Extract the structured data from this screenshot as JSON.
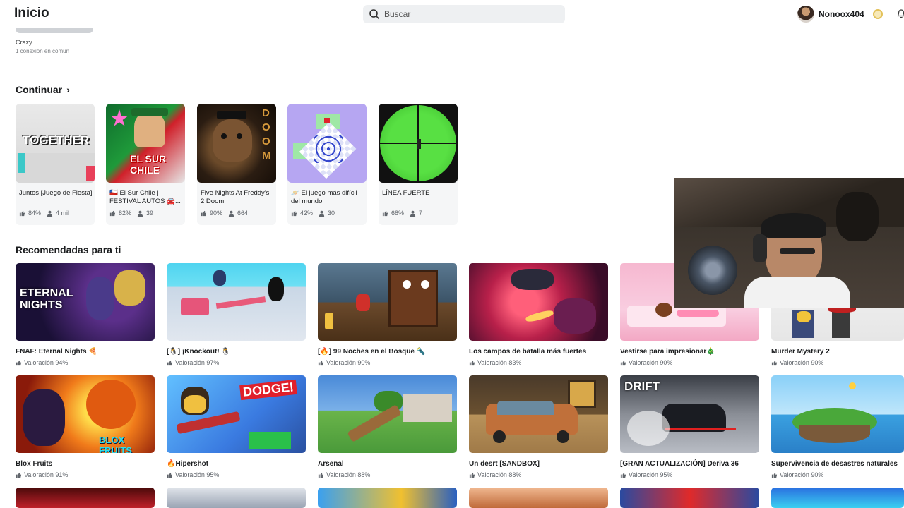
{
  "header": {
    "title": "Inicio",
    "search_placeholder": "Buscar",
    "username": "Nonoox404"
  },
  "friend": {
    "name": "Crazy",
    "subtitle": "1 conexión en común"
  },
  "continue_section": {
    "title": "Continuar",
    "items": [
      {
        "name": "Juntos [Juego de Fiesta]",
        "rating": "84%",
        "players": "4 mil",
        "thumb_text": "TOGETHER"
      },
      {
        "name": "🇨🇱 El Sur Chile | FESTIVAL AUTOS 🚘...",
        "rating": "82%",
        "players": "39",
        "thumb_text": "EL SUR CHILE"
      },
      {
        "name": "Five Nights At Freddy's 2 Doom",
        "rating": "90%",
        "players": "664",
        "thumb_text": "DOOM"
      },
      {
        "name": "🪐 El juego más difícil del mundo",
        "rating": "42%",
        "players": "30",
        "thumb_text": ""
      },
      {
        "name": "LÍNEA FUERTE",
        "rating": "68%",
        "players": "7",
        "thumb_text": ""
      }
    ]
  },
  "recommended_section": {
    "title": "Recomendadas para ti",
    "rows": [
      [
        {
          "name": "FNAF: Eternal Nights 🍕",
          "rating": "Valoración 94%",
          "thumb_text": "ETERNAL NIGHTS"
        },
        {
          "name": "[🐧] ¡Knockout! 🐧",
          "rating": "Valoración 97%",
          "thumb_text": ""
        },
        {
          "name": "[🔥] 99 Noches en el Bosque 🔦",
          "rating": "Valoración 90%",
          "thumb_text": ""
        },
        {
          "name": "Los campos de batalla más fuertes",
          "rating": "Valoración 83%",
          "thumb_text": ""
        },
        {
          "name": "Vestirse para impresionar🎄",
          "rating": "Valoración 90%",
          "thumb_text": ""
        },
        {
          "name": "Murder Mystery 2",
          "rating": "Valoración 90%",
          "thumb_text": ""
        }
      ],
      [
        {
          "name": "Blox Fruits",
          "rating": "Valoración 91%",
          "thumb_text": "BLOX FRUITS"
        },
        {
          "name": "🔥Hipershot",
          "rating": "Valoración 95%",
          "thumb_text": "DODGE!"
        },
        {
          "name": "Arsenal",
          "rating": "Valoración 88%",
          "thumb_text": ""
        },
        {
          "name": "Un desrt [SANDBOX]",
          "rating": "Valoración 88%",
          "thumb_text": ""
        },
        {
          "name": "[GRAN ACTUALIZACIÓN] Deriva 36",
          "rating": "Valoración 95%",
          "thumb_text": "DRIFT"
        },
        {
          "name": "Supervivencia de desastres naturales",
          "rating": "Valoración 90%",
          "thumb_text": ""
        }
      ]
    ]
  },
  "icons": {
    "search": "search-icon",
    "robux": "robux-icon",
    "notifications": "bell-icon",
    "thumbs_up": "thumbs-up-icon",
    "players": "players-icon"
  }
}
